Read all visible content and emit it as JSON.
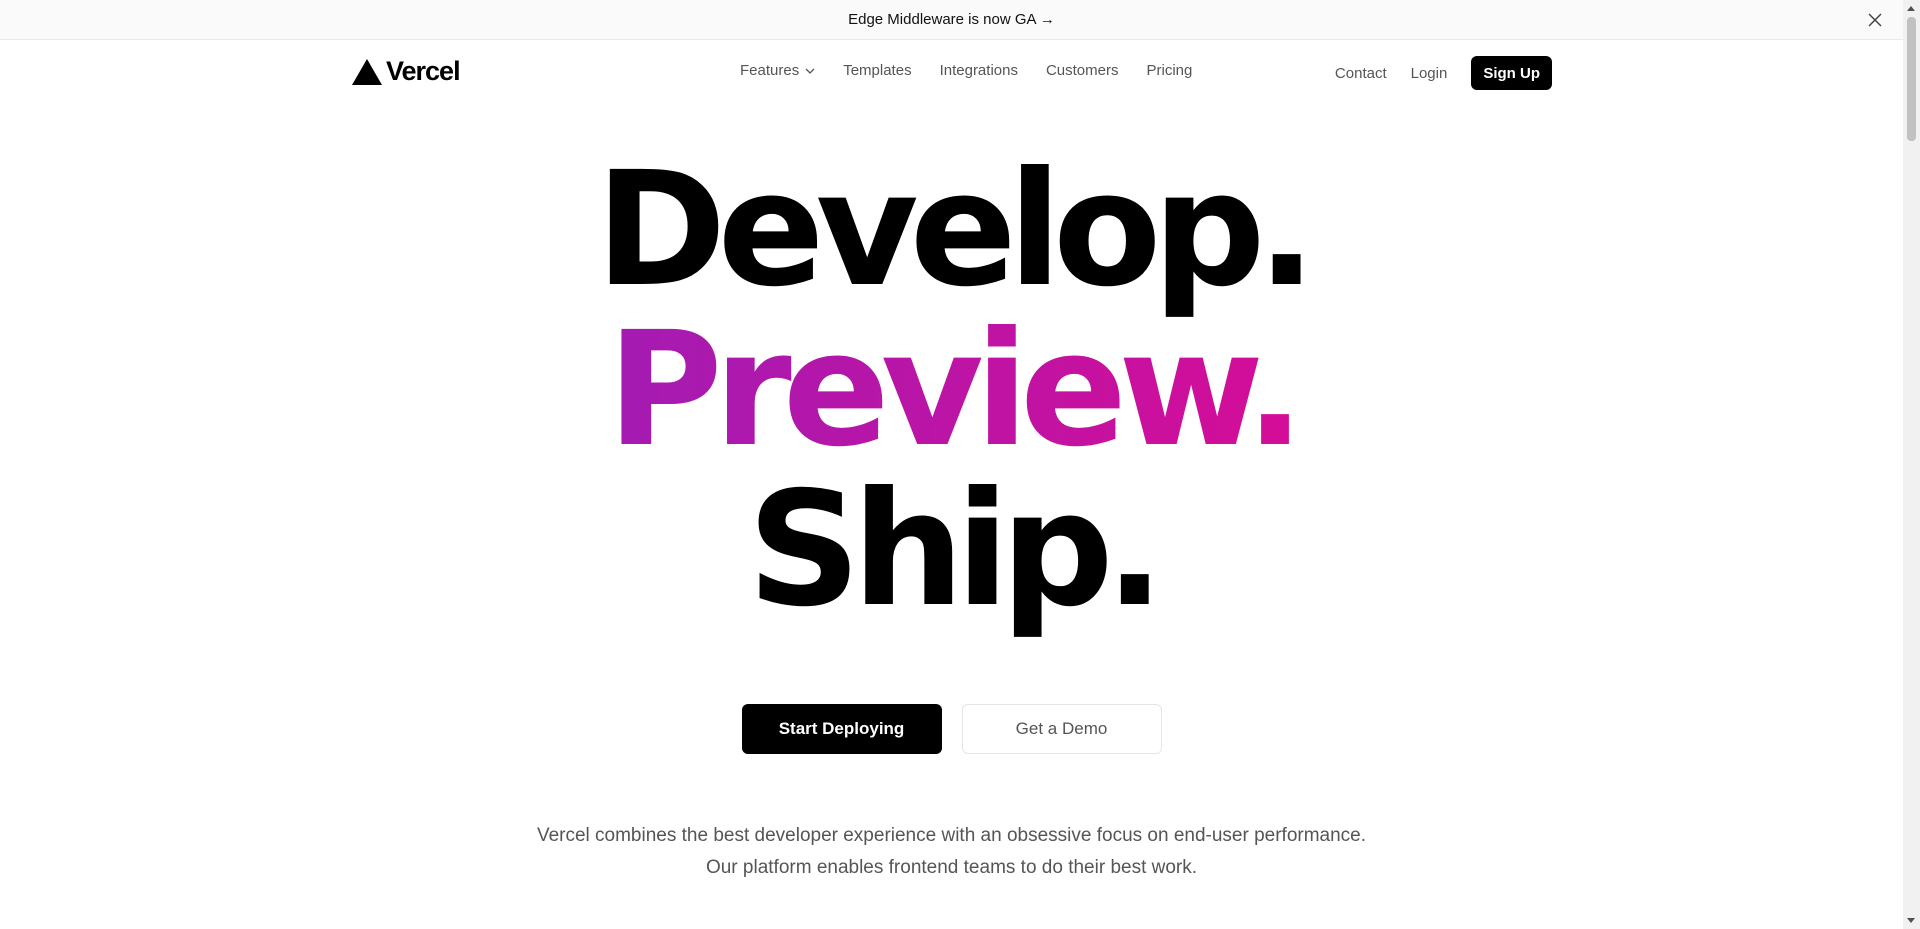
{
  "banner": {
    "text": "Edge Middleware is now GA →"
  },
  "nav": {
    "logo_text": "Vercel",
    "links": [
      "Features",
      "Templates",
      "Integrations",
      "Customers",
      "Pricing"
    ],
    "contact": "Contact",
    "login": "Login",
    "signup": "Sign Up"
  },
  "hero": {
    "line1": "Develop.",
    "line2": "Preview.",
    "line3": "Ship."
  },
  "cta": {
    "primary": "Start Deploying",
    "secondary": "Get a Demo"
  },
  "description": {
    "line1": "Vercel combines the best developer experience with an obsessive focus on end-user performance.",
    "line2": "Our platform enables frontend teams to do their best work."
  },
  "colors": {
    "gradient_start": "#7928ca",
    "gradient_end": "#ff0080",
    "primary": "#000000"
  }
}
